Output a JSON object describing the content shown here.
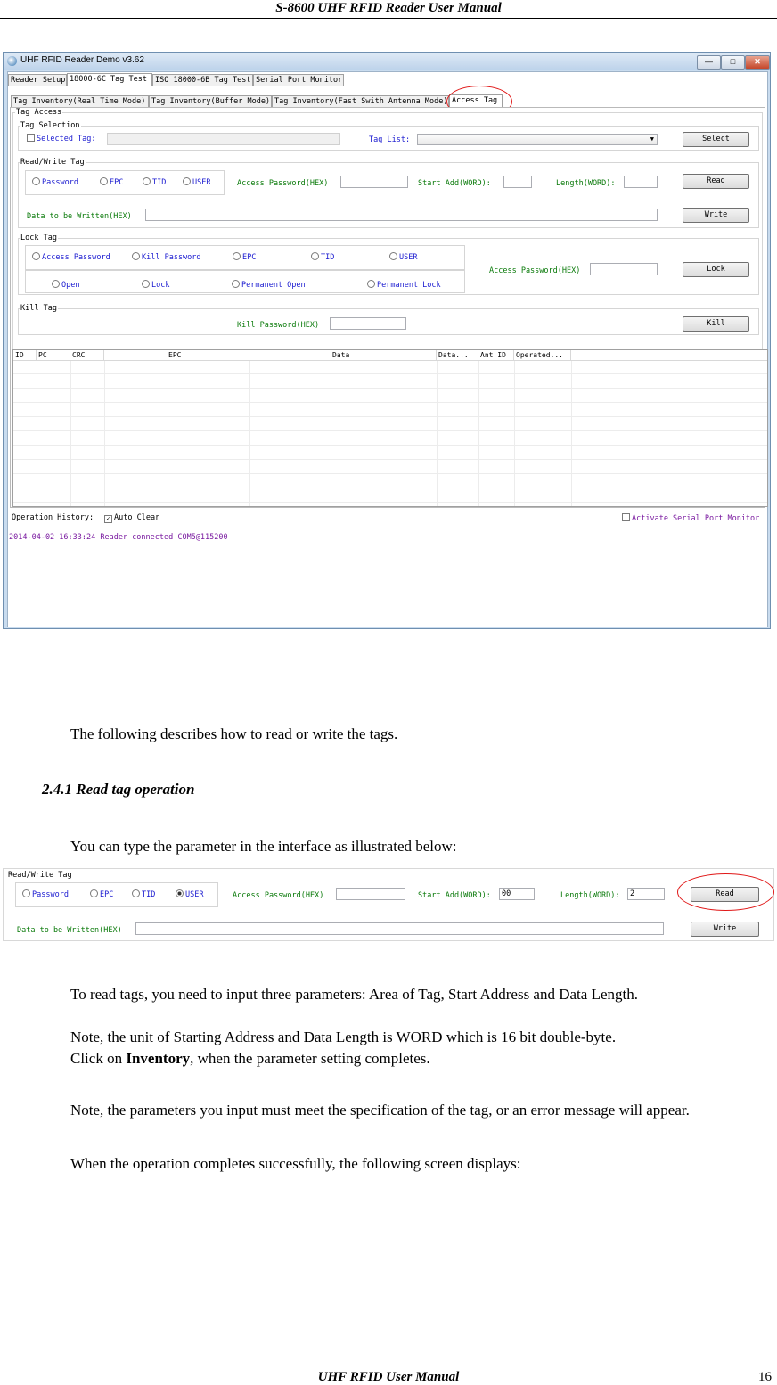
{
  "header": {
    "title": "S-8600 UHF RFID Reader User Manual"
  },
  "window": {
    "title": "UHF RFID Reader Demo v3.62",
    "controls": [
      "—",
      "□",
      "✕"
    ],
    "top_tabs": [
      "Reader Setup",
      "18000-6C Tag Test",
      "ISO 18000-6B Tag Test",
      "Serial Port Monitor"
    ],
    "sub_tabs": [
      "Tag Inventory(Real Time Mode)",
      "Tag Inventory(Buffer Mode)",
      "Tag Inventory(Fast Swith Antenna Mode)",
      "Access Tag"
    ],
    "tag_access": {
      "group_label": "Tag Access",
      "tag_selection": {
        "label": "Tag Selection",
        "selected_tag": "Selected Tag:",
        "tag_list": "Tag List:",
        "select_button": "Select"
      },
      "read_write": {
        "label": "Read/Write Tag",
        "areas": [
          "Password",
          "EPC",
          "TID",
          "USER"
        ],
        "access_password": "Access Password(HEX)",
        "start_add": "Start Add(WORD):",
        "length": "Length(WORD):",
        "read_button": "Read",
        "data_to_write": "Data to be Written(HEX)",
        "write_button": "Write"
      },
      "lock_tag": {
        "label": "Lock Tag",
        "areas": [
          "Access Password",
          "Kill Password",
          "EPC",
          "TID",
          "USER"
        ],
        "modes": [
          "Open",
          "Lock",
          "Permanent Open",
          "Permanent Lock"
        ],
        "access_password": "Access Password(HEX)",
        "lock_button": "Lock"
      },
      "kill_tag": {
        "label": "Kill Tag",
        "kill_password": "Kill Password(HEX)",
        "kill_button": "Kill"
      }
    },
    "table_columns": [
      "ID",
      "PC",
      "CRC",
      "EPC",
      "Data",
      "Data...",
      "Ant ID",
      "Operated..."
    ],
    "history": {
      "label": "Operation History:",
      "auto_clear": "Auto Clear",
      "monitor": "Activate Serial Port Monitor",
      "log": "2014-04-02 16:33:24 Reader connected COM5@115200"
    }
  },
  "text": {
    "p1": "The following describes how to read or write the tags.",
    "h241": "2.4.1 Read tag operation",
    "p2": "You can type the parameter in the interface as illustrated below:",
    "p3": "To read tags, you need to input three parameters: Area of Tag, Start Address and Data Length.",
    "p4": "Note, the unit of Starting Address and Data Length is WORD which is 16 bit double-byte.",
    "p5_pre": "Click on ",
    "p5_bold": "Inventory",
    "p5_post": ", when the parameter setting completes.",
    "p6": "Note, the parameters you input must meet the specification of the tag, or an error message will appear.",
    "p7": "When the operation completes successfully, the following screen displays:"
  },
  "shot2": {
    "label": "Read/Write Tag",
    "areas": [
      "Password",
      "EPC",
      "TID",
      "USER"
    ],
    "selected_area": "USER",
    "access_password": "Access Password(HEX)",
    "start_add": "Start Add(WORD):",
    "start_value": "00",
    "length": "Length(WORD):",
    "length_value": "2",
    "read_button": "Read",
    "data_to_write": "Data to be Written(HEX)",
    "write_button": "Write"
  },
  "footer": {
    "title": "UHF RFID User Manual",
    "page": "16"
  }
}
